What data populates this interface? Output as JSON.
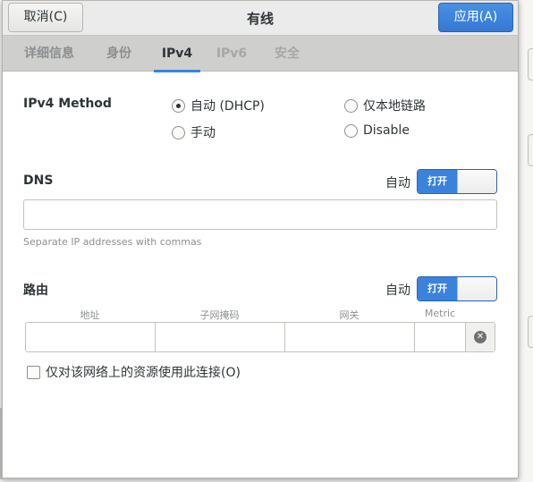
{
  "header": {
    "cancel_label": "取消(C)",
    "title": "有线",
    "apply_label": "应用(A)"
  },
  "tabs": [
    {
      "label": "详细信息",
      "state": "normal"
    },
    {
      "label": "身份",
      "state": "normal"
    },
    {
      "label": "IPv4",
      "state": "active"
    },
    {
      "label": "IPv6",
      "state": "disabled"
    },
    {
      "label": "安全",
      "state": "disabled"
    }
  ],
  "ipv4": {
    "method_label": "IPv4 Method",
    "options": [
      {
        "label": "自动 (DHCP)",
        "checked": true
      },
      {
        "label": "仅本地链路",
        "checked": false
      },
      {
        "label": "手动",
        "checked": false
      },
      {
        "label": "Disable",
        "checked": false
      }
    ]
  },
  "dns": {
    "label": "DNS",
    "auto_label": "自动",
    "switch_label": "打开",
    "switch_on": true,
    "value": "",
    "hint": "Separate IP addresses with commas"
  },
  "routes": {
    "label": "路由",
    "auto_label": "自动",
    "switch_label": "打开",
    "switch_on": true,
    "columns": [
      "地址",
      "子网掩码",
      "网关",
      "Metric"
    ],
    "rows": [
      {
        "address": "",
        "netmask": "",
        "gateway": "",
        "metric": ""
      }
    ]
  },
  "only_local_resources": {
    "label": "仅对该网络上的资源使用此连接(O)",
    "checked": false
  },
  "icons": {
    "delete_route": "clear-icon"
  },
  "colors": {
    "accent": "#3584e4",
    "apply_button": "#3478d4"
  }
}
